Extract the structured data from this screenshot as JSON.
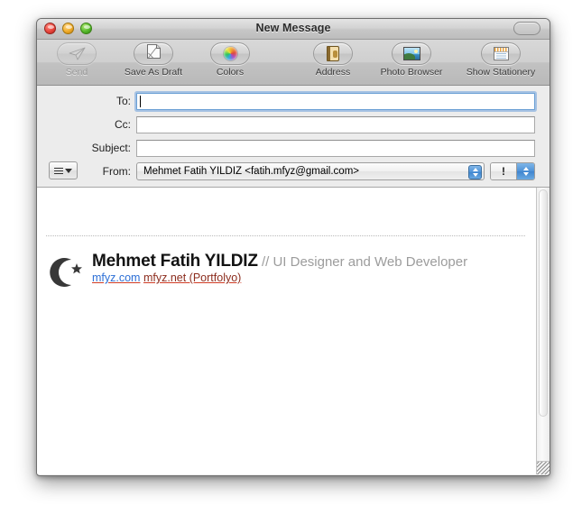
{
  "window": {
    "title": "New Message",
    "traffic_lights": [
      "close",
      "minimize",
      "zoom"
    ],
    "toolbar_toggle_name": "toolbar-toggle"
  },
  "toolbar": {
    "left_items": [
      {
        "label": "Send",
        "icon": "send-icon",
        "disabled": true
      },
      {
        "label": "Save As Draft",
        "icon": "save-draft-icon",
        "disabled": false
      },
      {
        "label": "Colors",
        "icon": "colors-icon",
        "disabled": false
      }
    ],
    "right_items": [
      {
        "label": "Address",
        "icon": "address-book-icon"
      },
      {
        "label": "Photo Browser",
        "icon": "photo-browser-icon"
      },
      {
        "label": "Show Stationery",
        "icon": "stationery-icon"
      }
    ]
  },
  "headers": {
    "to": {
      "label": "To:",
      "value": "",
      "focused": true
    },
    "cc": {
      "label": "Cc:",
      "value": ""
    },
    "subject": {
      "label": "Subject:",
      "value": ""
    },
    "from": {
      "label": "From:",
      "value": "Mehmet Fatih YILDIZ <fatih.mfyz@gmail.com>",
      "options": [
        "Mehmet Fatih YILDIZ <fatih.mfyz@gmail.com>"
      ]
    },
    "header_menu_icon": "hamburger-menu-icon",
    "priority": {
      "glyph": "!",
      "label": "priority"
    }
  },
  "message": {
    "body_text": "",
    "signature": {
      "logo": "crescent-moon-star-icon",
      "name": "Mehmet Fatih YILDIZ",
      "tagline": "// UI Designer and Web Developer",
      "links": [
        {
          "text": "mfyz.com",
          "style": "blue"
        },
        {
          "text": "mfyz.net (Portfolyo)",
          "style": "red"
        }
      ]
    }
  },
  "colors": {
    "accent_blue": "#4f93d8",
    "link_blue": "#2c6fd6",
    "link_red": "#8c2d1e",
    "underline_red": "#d03c26",
    "toolbar_bg": "#cfcfcf",
    "header_bg": "#ececec"
  }
}
